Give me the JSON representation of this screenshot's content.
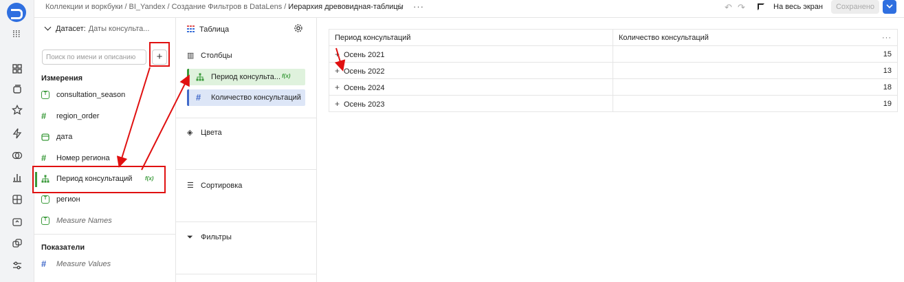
{
  "header": {
    "breadcrumbs": [
      "Коллекции и воркбуки",
      "BI_Yandex",
      "Создание Фильтров в DataLens"
    ],
    "current": "Иерархия древовидная-таблицы",
    "fullscreen_label": "На весь экран",
    "saved_label": "Сохранено"
  },
  "dataset": {
    "label": "Датасет:",
    "value": "Даты консульта...",
    "search_placeholder": "Поиск по имени и описанию",
    "add_label": "+",
    "dimensions_title": "Измерения",
    "dimensions": [
      {
        "name": "consultation_season",
        "type": "text"
      },
      {
        "name": "region_order",
        "type": "number"
      },
      {
        "name": "дата",
        "type": "date"
      },
      {
        "name": "Номер региона",
        "type": "number"
      },
      {
        "name": "Период консультаций",
        "type": "hierarchy",
        "badge": "f(x)"
      },
      {
        "name": "регион",
        "type": "text"
      },
      {
        "name": "Measure Names",
        "type": "text"
      }
    ],
    "measures_title": "Показатели",
    "measures": [
      {
        "name": "Measure Values",
        "type": "number"
      }
    ]
  },
  "visualization": {
    "type_label": "Таблица",
    "columns_title": "Столбцы",
    "columns": [
      {
        "name": "Период консульта...",
        "badge": "f(x)"
      },
      {
        "name": "Количество консультаций"
      }
    ],
    "colors_title": "Цвета",
    "sort_title": "Сортировка",
    "filters_title": "Фильтры"
  },
  "table": {
    "headers": [
      "Период консультаций",
      "Количество консультаций"
    ],
    "more_label": "···",
    "rows": [
      {
        "period": "Осень 2021",
        "count": "15"
      },
      {
        "period": "Осень 2022",
        "count": "13"
      },
      {
        "period": "Осень 2024",
        "count": "18"
      },
      {
        "period": "Осень 2023",
        "count": "19"
      }
    ]
  },
  "colors": {
    "accent": "#2f6fe0",
    "dimension": "#3a9a3a",
    "measure": "#4169c9",
    "annotation": "#e01010"
  }
}
